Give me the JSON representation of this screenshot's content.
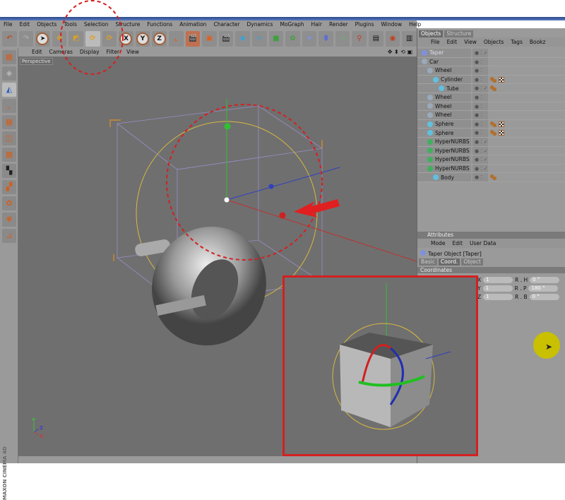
{
  "menubar": [
    "File",
    "Edit",
    "Objects",
    "Tools",
    "Selection",
    "Structure",
    "Functions",
    "Animation",
    "Character",
    "Dynamics",
    "MoGraph",
    "Hair",
    "Render",
    "Plugins",
    "Window",
    "Help"
  ],
  "toolbar": {
    "x_label": "X",
    "y_label": "Y",
    "z_label": "Z"
  },
  "viewport": {
    "menu": [
      "Edit",
      "Cameras",
      "Display",
      "Filter",
      "View"
    ],
    "label": "Perspective",
    "nav_icons": "✥ ⬍ ⟲ ▣"
  },
  "branding": "MAXON CINEMA 4D",
  "axis": {
    "x": "X",
    "y": "Y",
    "z": "Z"
  },
  "objects_panel": {
    "tabs": [
      "Objects",
      "Structure"
    ],
    "menu": [
      "File",
      "Edit",
      "View",
      "Objects",
      "Tags",
      "Bookz"
    ],
    "items": [
      {
        "name": "Taper",
        "depth": 0,
        "icon": "taper-icon",
        "color": "#8090e0",
        "tags": [],
        "check": true
      },
      {
        "name": "Car",
        "depth": 0,
        "icon": "null-icon",
        "color": "#9ab",
        "tags": [],
        "check": false
      },
      {
        "name": "Wheel",
        "depth": 1,
        "icon": "null-icon",
        "color": "#9ab",
        "tags": [],
        "check": false
      },
      {
        "name": "Cylinder",
        "depth": 2,
        "icon": "cylinder-icon",
        "color": "#60c0e0",
        "tags": [
          "beads",
          "mat"
        ],
        "check": false
      },
      {
        "name": "Tube",
        "depth": 3,
        "icon": "tube-icon",
        "color": "#60c0e0",
        "tags": [
          "beads"
        ],
        "check": true
      },
      {
        "name": "Wheel",
        "depth": 1,
        "icon": "null-icon",
        "color": "#9ab",
        "tags": [],
        "check": false
      },
      {
        "name": "Wheel",
        "depth": 1,
        "icon": "null-icon",
        "color": "#9ab",
        "tags": [],
        "check": false
      },
      {
        "name": "Wheel",
        "depth": 1,
        "icon": "null-icon",
        "color": "#9ab",
        "tags": [],
        "check": false
      },
      {
        "name": "Sphere",
        "depth": 1,
        "icon": "sphere-icon",
        "color": "#60c0e0",
        "tags": [
          "beads",
          "mat"
        ],
        "check": false
      },
      {
        "name": "Sphere",
        "depth": 1,
        "icon": "sphere-icon",
        "color": "#60c0e0",
        "tags": [
          "beads",
          "mat"
        ],
        "check": false
      },
      {
        "name": "HyperNURBS",
        "depth": 1,
        "icon": "hypernurbs-icon",
        "color": "#40b060",
        "tags": [],
        "check": true
      },
      {
        "name": "HyperNURBS",
        "depth": 1,
        "icon": "hypernurbs-icon",
        "color": "#40b060",
        "tags": [],
        "check": true
      },
      {
        "name": "HyperNURBS",
        "depth": 1,
        "icon": "hypernurbs-icon",
        "color": "#40b060",
        "tags": [],
        "check": true
      },
      {
        "name": "HyperNURBS",
        "depth": 1,
        "icon": "hypernurbs-icon",
        "color": "#40b060",
        "tags": [],
        "check": true
      },
      {
        "name": "Body",
        "depth": 2,
        "icon": "cone-icon",
        "color": "#60c0e0",
        "tags": [
          "beads"
        ],
        "check": false
      }
    ]
  },
  "attributes": {
    "title": "Attributes",
    "menu": [
      "Mode",
      "Edit",
      "User Data"
    ],
    "object_title": "Taper Object [Taper]",
    "tabs": [
      "Basic",
      "Coord.",
      "Object"
    ],
    "section": "Coordinates",
    "fields": [
      {
        "label": "X",
        "value": "1",
        "rlabel": "R . H",
        "rvalue": "0 °"
      },
      {
        "label": "Y",
        "value": "1",
        "rlabel": "R . P",
        "rvalue": "180 °"
      },
      {
        "label": "Z",
        "value": "1",
        "rlabel": "R . B",
        "rvalue": "0 °"
      }
    ]
  },
  "colors": {
    "annotation": "#d42020",
    "cursor_highlight": "#c8c000",
    "viewport_bg": "#6f6f6f"
  }
}
